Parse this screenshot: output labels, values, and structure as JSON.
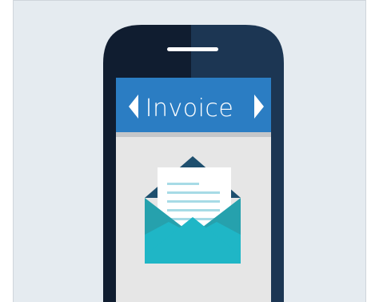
{
  "screen": {
    "title": "Invoice"
  },
  "colors": {
    "background": "#e5ebf0",
    "phone_body_left": "#101d30",
    "phone_body_right": "#1c3653",
    "speaker": "#ffffff",
    "header_bar": "#2b7dc3",
    "header_shadow": "#c4c6c9",
    "screen_bg": "#e6e6e6",
    "envelope_back": "#1e4f6e",
    "envelope_body": "#26a1ad",
    "envelope_flap_front": "#1fb6c6",
    "paper": "#ffffff",
    "paper_lines": "#a7dbe6"
  },
  "icons": {
    "nav_prev": "chevron-left-icon",
    "nav_next": "chevron-right-icon",
    "envelope": "envelope-icon"
  }
}
